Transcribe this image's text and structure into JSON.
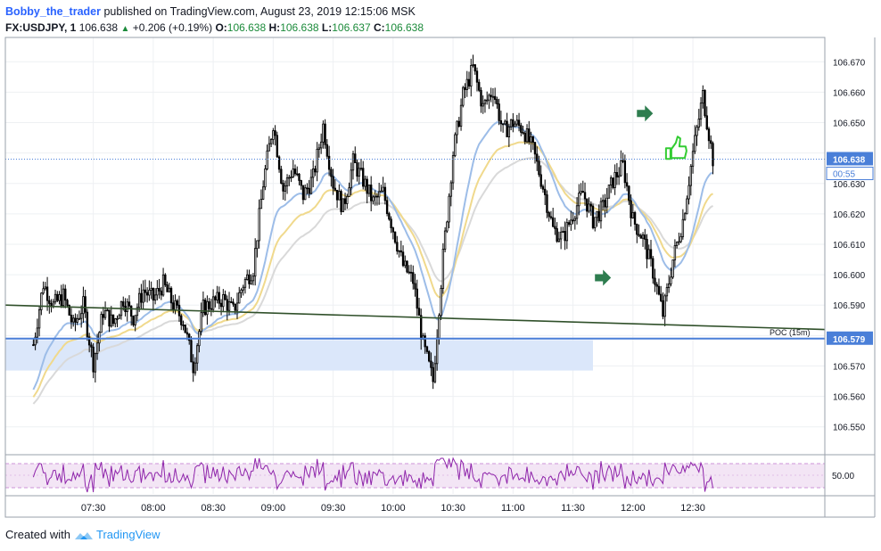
{
  "header": {
    "author": "Bobby_the_trader",
    "published_text": "published on TradingView.com, August 23, 2019 12:15:06 MSK",
    "symbol": "FX:USDJPY, 1",
    "last": "106.638",
    "change_arrow": "▲",
    "change": "+0.206 (+0.19%)",
    "o_label": "O:",
    "o_value": "106.638",
    "h_label": "H:",
    "h_value": "106.638",
    "l_label": "L:",
    "l_value": "106.637",
    "c_label": "C:",
    "c_value": "106.638"
  },
  "footer": {
    "created_with": "Created with",
    "brand": "TradingView"
  },
  "chart_data": {
    "type": "candlestick",
    "symbol": "FX:USDJPY",
    "interval": "1",
    "ylim": [
      106.542,
      106.678
    ],
    "y_ticks": [
      "106.670",
      "106.660",
      "106.650",
      "106.640",
      "106.630",
      "106.620",
      "106.610",
      "106.600",
      "106.590",
      "106.580",
      "106.570",
      "106.560",
      "106.550"
    ],
    "x_ticks": [
      "07:30",
      "08:00",
      "08:30",
      "09:00",
      "09:30",
      "10:00",
      "10:30",
      "11:00",
      "11:30",
      "12:00",
      "12:30"
    ],
    "price_label": "106.638",
    "countdown_label": "00:55",
    "poc": {
      "label": "POC (15m)",
      "value": "106.579",
      "price": 106.579
    },
    "zone": {
      "low": 106.5685,
      "high": 106.5785
    },
    "trendline": {
      "from_time": "07:00",
      "from_price": 106.59,
      "to_time": "13:00",
      "to_price": 106.582
    },
    "colors": {
      "ma_fast": "#9dbde8",
      "ma_mid": "#f0d98c",
      "ma_slow": "#d9d9d9",
      "poc": "#4a7fd8",
      "trendline": "#30502a",
      "zone": "#dbe7fa",
      "rsi": "#8e24aa",
      "rsi_band": "#f3e5f5",
      "arrow": "#2e7d4f",
      "thumb": "#33cc33",
      "price_label_bg": "#4a7fd8"
    },
    "annotations": [
      {
        "type": "arrow-right",
        "time": "11:45",
        "price": 106.599
      },
      {
        "type": "arrow-right",
        "time": "12:06",
        "price": 106.653
      },
      {
        "type": "thumbs-up",
        "time": "12:21",
        "price": 106.641
      }
    ],
    "close_series_points": [
      [
        "07:00",
        106.577
      ],
      [
        "07:05",
        106.597
      ],
      [
        "07:10",
        106.59
      ],
      [
        "07:15",
        106.593
      ],
      [
        "07:20",
        106.583
      ],
      [
        "07:25",
        106.59
      ],
      [
        "07:30",
        106.571
      ],
      [
        "07:35",
        106.588
      ],
      [
        "07:40",
        106.584
      ],
      [
        "07:45",
        106.592
      ],
      [
        "07:50",
        106.586
      ],
      [
        "07:55",
        106.595
      ],
      [
        "08:00",
        106.592
      ],
      [
        "08:05",
        106.597
      ],
      [
        "08:10",
        106.59
      ],
      [
        "08:15",
        106.585
      ],
      [
        "08:20",
        106.57
      ],
      [
        "08:25",
        106.589
      ],
      [
        "08:30",
        106.591
      ],
      [
        "08:35",
        106.592
      ],
      [
        "08:40",
        106.588
      ],
      [
        "08:45",
        106.597
      ],
      [
        "08:50",
        106.602
      ],
      [
        "08:55",
        106.63
      ],
      [
        "09:00",
        106.65
      ],
      [
        "09:05",
        106.628
      ],
      [
        "09:10",
        106.635
      ],
      [
        "09:15",
        106.626
      ],
      [
        "09:20",
        106.632
      ],
      [
        "09:25",
        106.649
      ],
      [
        "09:30",
        106.63
      ],
      [
        "09:35",
        106.622
      ],
      [
        "09:40",
        106.637
      ],
      [
        "09:45",
        106.631
      ],
      [
        "09:50",
        106.624
      ],
      [
        "09:55",
        106.627
      ],
      [
        "10:00",
        106.615
      ],
      [
        "10:05",
        106.603
      ],
      [
        "10:10",
        106.598
      ],
      [
        "10:15",
        106.577
      ],
      [
        "10:20",
        106.565
      ],
      [
        "10:25",
        106.606
      ],
      [
        "10:30",
        106.64
      ],
      [
        "10:35",
        106.659
      ],
      [
        "10:40",
        106.668
      ],
      [
        "10:45",
        106.655
      ],
      [
        "10:50",
        106.661
      ],
      [
        "10:55",
        106.647
      ],
      [
        "11:00",
        106.65
      ],
      [
        "11:05",
        106.648
      ],
      [
        "11:10",
        106.641
      ],
      [
        "11:15",
        106.629
      ],
      [
        "11:20",
        106.615
      ],
      [
        "11:25",
        106.612
      ],
      [
        "11:30",
        106.62
      ],
      [
        "11:35",
        106.627
      ],
      [
        "11:40",
        106.618
      ],
      [
        "11:45",
        106.622
      ],
      [
        "11:50",
        106.631
      ],
      [
        "11:55",
        106.636
      ],
      [
        "12:00",
        106.618
      ],
      [
        "12:05",
        106.612
      ],
      [
        "12:10",
        106.601
      ],
      [
        "12:15",
        106.587
      ],
      [
        "12:20",
        106.605
      ],
      [
        "12:25",
        106.618
      ],
      [
        "12:30",
        106.64
      ],
      [
        "12:35",
        106.659
      ],
      [
        "12:40",
        106.638
      ]
    ],
    "rsi": {
      "label": "50.00",
      "level": 50.0
    }
  }
}
